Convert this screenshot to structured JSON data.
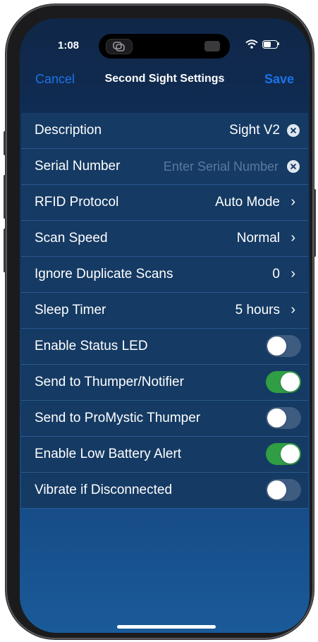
{
  "status_bar": {
    "time": "1:08"
  },
  "nav": {
    "cancel_label": "Cancel",
    "title": "Second Sight Settings",
    "save_label": "Save"
  },
  "rows": [
    {
      "label": "Description",
      "value": "Sight V2",
      "accessory": "clear"
    },
    {
      "label": "Serial Number",
      "placeholder": "Enter Serial Number",
      "accessory": "clear"
    },
    {
      "label": "RFID Protocol",
      "value": "Auto Mode",
      "accessory": "chevron"
    },
    {
      "label": "Scan Speed",
      "value": "Normal",
      "accessory": "chevron"
    },
    {
      "label": "Ignore Duplicate Scans",
      "value": "0",
      "accessory": "chevron"
    },
    {
      "label": "Sleep Timer",
      "value": "5 hours",
      "accessory": "chevron"
    },
    {
      "label": "Enable Status LED",
      "toggle": false
    },
    {
      "label": "Send to Thumper/Notifier",
      "toggle": true
    },
    {
      "label": "Send to ProMystic Thumper",
      "toggle": false
    },
    {
      "label": "Enable Low Battery Alert",
      "toggle": true
    },
    {
      "label": "Vibrate if Disconnected",
      "toggle": false
    }
  ],
  "icons": {
    "chevron": "chevron-right-icon",
    "clear": "clear-circle-icon"
  },
  "colors": {
    "accent": "#1a73e8",
    "toggle_on": "#2f9e44",
    "toggle_off": "#3e5c80",
    "row_bg": "#153a63"
  }
}
